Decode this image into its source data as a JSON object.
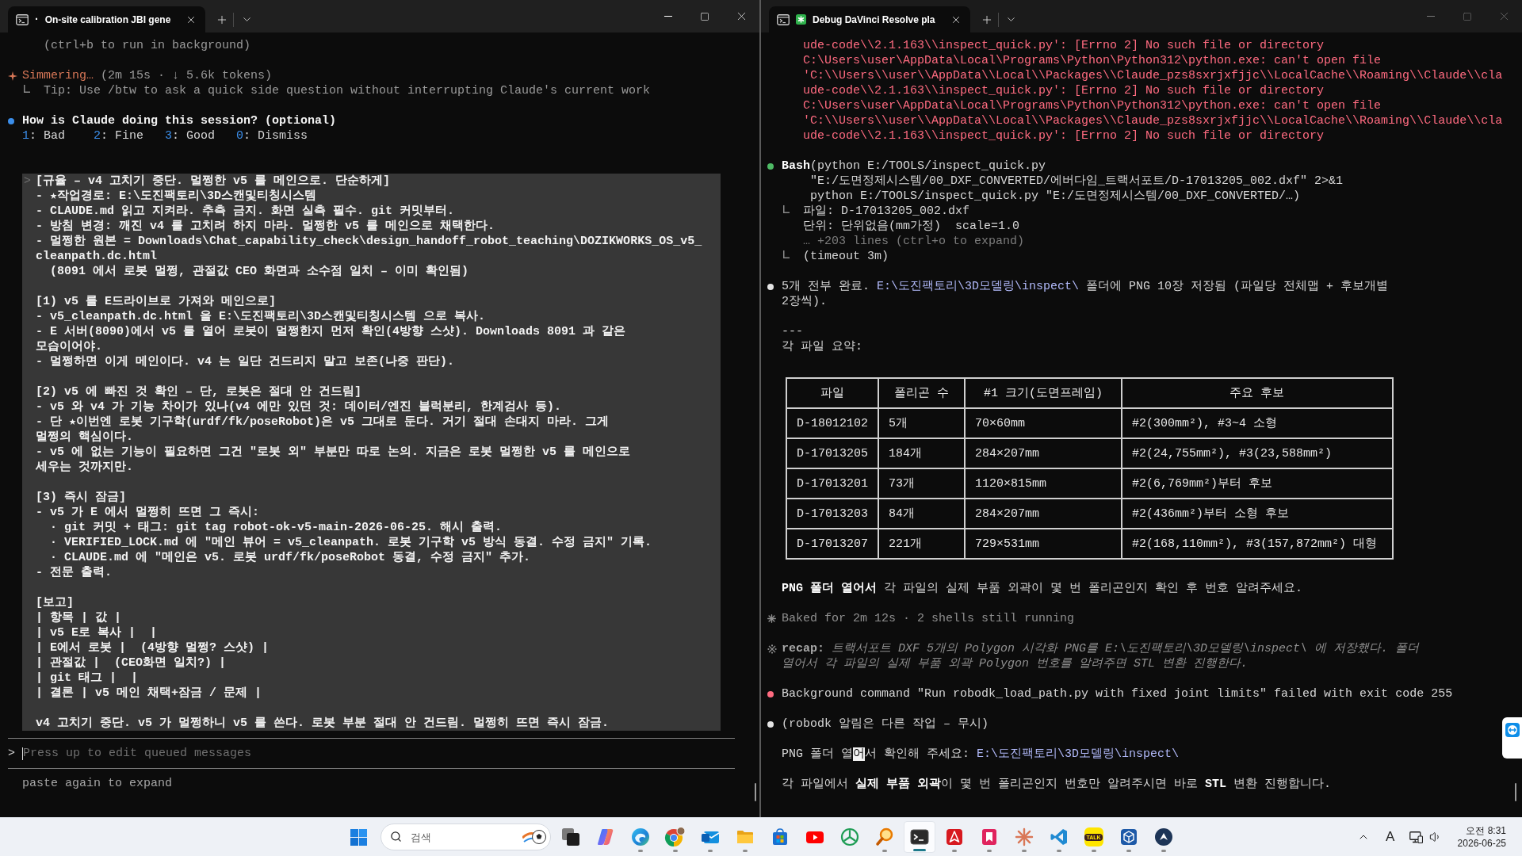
{
  "left_window": {
    "focused": true,
    "tab": {
      "prefix": "·",
      "badge": false,
      "title": "On-site calibration JBI gene",
      "selected": true
    },
    "output": {
      "background_hint": "(ctrl+b to run in background)",
      "spinner": {
        "verb": "Simmering…",
        "detail": "(2m 15s · ↓ 5.6k tokens)"
      },
      "tip": "Tip: Use /btw to ask a quick side question without interrupting Claude's current work",
      "survey": {
        "question": "How is Claude doing this session? (optional)",
        "separator": ":",
        "options": [
          {
            "key": "1",
            "label": "Bad"
          },
          {
            "key": "2",
            "label": "Fine"
          },
          {
            "key": "3",
            "label": "Good"
          },
          {
            "key": "0",
            "label": "Dismiss"
          }
        ]
      }
    },
    "pasted_block": {
      "prompt": ">",
      "groups": [
        [
          {
            "lines": [
              "[규율 – v4 고치기 중단. 멀쩡한 v5 를 메인으로. 단순하게]"
            ]
          },
          {
            "lines": [
              "- ★작업경로: E:\\도진팩토리\\3D스캔및티칭시스템"
            ]
          },
          {
            "lines": [
              "- CLAUDE.md 읽고 지켜라. 추측 금지. 화면 실측 필수. git 커밋부터."
            ]
          },
          {
            "lines": [
              "- 방침 변경: 깨진 v4 를 고치려 하지 마라. 멀쩡한 v5 를 메인으로 채택한다."
            ]
          },
          {
            "lines": [
              "- 멀쩡한 원본 = Downloads\\Chat_capability_check\\design_handoff_robot_teaching\\DOZIKWORKS_OS_v5_",
              "cleanpath.dc.html"
            ],
            "children": [
              {
                "lines": [
                  "(8091 에서 로봇 멀쩡, 관절값 CEO 화면과 소수점 일치 – 이미 확인됨)"
                ]
              }
            ]
          }
        ],
        [
          {
            "lines": [
              "[1) v5 를 E드라이브로 가져와 메인으로]"
            ]
          },
          {
            "lines": [
              "- v5_cleanpath.dc.html 을 E:\\도진팩토리\\3D스캔및티칭시스템 으로 복사."
            ]
          },
          {
            "lines": [
              "- E 서버(8090)에서 v5 를 열어 로봇이 멀쩡한지 먼저 확인(4방향 스샷). Downloads 8091 과 같은",
              "모습이어야."
            ]
          },
          {
            "lines": [
              "- 멀쩡하면 이게 메인이다. v4 는 일단 건드리지 말고 보존(나중 판단)."
            ]
          }
        ],
        [
          {
            "lines": [
              "[2) v5 에 빠진 것 확인 – 단, 로봇은 절대 안 건드림]"
            ]
          },
          {
            "lines": [
              "- v5 와 v4 가 기능 차이가 있나(v4 에만 있던 것: 데이터/엔진 블럭분리, 한계검사 등)."
            ]
          },
          {
            "lines": [
              "- 단 ★이번엔 로봇 기구학(urdf/fk/poseRobot)은 v5 그대로 둔다. 거기 절대 손대지 마라. 그게",
              "멀쩡의 핵심이다."
            ]
          },
          {
            "lines": [
              "- v5 에 없는 기능이 필요하면 그건 \"로봇 외\" 부분만 따로 논의. 지금은 로봇 멀쩡한 v5 를 메인으로",
              "세우는 것까지만."
            ]
          }
        ],
        [
          {
            "lines": [
              "[3) 즉시 잠금]"
            ]
          },
          {
            "lines": [
              "- v5 가 E 에서 멀쩡히 뜨면 그 즉시:"
            ],
            "children": [
              {
                "lines": [
                  "· git 커밋 + 태그: git tag robot-ok-v5-main-2026-06-25. 해시 출력."
                ]
              },
              {
                "lines": [
                  "· VERIFIED_LOCK.md 에 \"메인 뷰어 = v5_cleanpath. 로봇 기구학 v5 방식 동결. 수정 금지\" 기록."
                ]
              },
              {
                "lines": [
                  "· CLAUDE.md 에 \"메인은 v5. 로봇 urdf/fk/poseRobot 동결, 수정 금지\" 추가."
                ]
              }
            ]
          },
          {
            "lines": [
              "- 전문 출력."
            ]
          }
        ],
        [
          {
            "lines": [
              "[보고]"
            ]
          },
          {
            "lines": [
              "| 항목 | 값 |"
            ]
          },
          {
            "lines": [
              "| v5 E로 복사 |  |"
            ]
          },
          {
            "lines": [
              "| E에서 로봇 |  (4방향 멀쩡? 스샷) |"
            ]
          },
          {
            "lines": [
              "| 관절값 |  (CEO화면 일치?) |"
            ]
          },
          {
            "lines": [
              "| git 태그 |  |"
            ]
          },
          {
            "lines": [
              "| 결론 | v5 메인 채택+잠금 / 문제 |"
            ]
          }
        ],
        [
          {
            "lines": [
              "v4 고치기 중단. v5 가 멀쩡하니 v5 를 쓴다. 로봇 부분 절대 안 건드림. 멀쩡히 뜨면 즉시 잠금."
            ]
          }
        ]
      ]
    },
    "input": {
      "prompt": ">",
      "placeholder": "Press up to edit queued messages"
    },
    "footer": "paste again to expand"
  },
  "right_window": {
    "focused": false,
    "tab": {
      "badge": true,
      "title": "Debug DaVinci Resolve pla",
      "selected": true
    },
    "transcript": [
      {
        "kind": "error_output",
        "lines": [
          "ude-code\\\\2.1.163\\\\inspect_quick.py': [Errno 2] No such file or directory",
          "C:\\Users\\user\\AppData\\Local\\Programs\\Python\\Python312\\python.exe: can't open file",
          "'C:\\\\Users\\\\user\\\\AppData\\\\Local\\\\Packages\\\\Claude_pzs8sxrjxfjjc\\\\LocalCache\\\\Roaming\\\\Claude\\\\cla",
          "ude-code\\\\2.1.163\\\\inspect_quick.py': [Errno 2] No such file or directory",
          "C:\\Users\\user\\AppData\\Local\\Programs\\Python\\Python312\\python.exe: can't open file",
          "'C:\\\\Users\\\\user\\\\AppData\\\\Local\\\\Packages\\\\Claude_pzs8sxrjxfjjc\\\\LocalCache\\\\Roaming\\\\Claude\\\\cla",
          "ude-code\\\\2.1.163\\\\inspect_quick.py': [Errno 2] No such file or directory"
        ]
      },
      {
        "kind": "tool_call",
        "color": "#4eba65",
        "command": [
          "**Bash**(python E:/TOOLS/inspect_quick.py",
          "\"E:/도면정제시스템/00_DXF_CONVERTED/에버다임_트랙서포트/D-17013205_002.dxf\" 2>&1",
          "python E:/TOOLS/inspect_quick.py \"E:/도면정제시스템/00_DXF_CONVERTED/…)"
        ],
        "result": [
          {
            "text": "파일: D-17013205_002.dxf",
            "dim": false
          },
          {
            "text": "단위: 단위없음(mm가정)  scale=1.0",
            "dim": false
          },
          {
            "text": "… +203 lines (ctrl+o to expand)",
            "dim": true
          }
        ],
        "footer": "(timeout 3m)"
      },
      {
        "kind": "message",
        "color": "#e4e4e4",
        "lines": [
          [
            {
              "kind": "plain",
              "text": "5개 전부 완료. "
            },
            {
              "kind": "path",
              "text": "E:\\도진팩토리\\3D모델링\\inspect\\"
            },
            {
              "kind": "plain",
              "text": " 폴더에 PNG 10장 저장됨 (파일당 전체맵 + 후보개별"
            }
          ],
          [
            {
              "kind": "plain",
              "text": "2장씩)."
            }
          ]
        ]
      },
      {
        "kind": "rule",
        "text": "---"
      },
      {
        "kind": "text",
        "lines": [
          [
            {
              "kind": "plain",
              "text": "각 파일 요약:"
            }
          ]
        ]
      },
      {
        "kind": "table",
        "columns": [
          "파일",
          "폴리곤 수",
          "#1 크기(도면프레임)",
          "주요 후보"
        ],
        "rows": [
          [
            "D-18012102",
            "5개",
            "70×60mm",
            "#2(300mm²), #3~4 소형"
          ],
          [
            "D-17013205",
            "184개",
            "284×207mm",
            "#2(24,755mm²), #3(23,588mm²)"
          ],
          [
            "D-17013201",
            "73개",
            "1120×815mm",
            "#2(6,769mm²)부터 후보"
          ],
          [
            "D-17013203",
            "84개",
            "284×207mm",
            "#2(436mm²)부터 소형 후보"
          ],
          [
            "D-17013207",
            "221개",
            "729×531mm",
            "#2(168,110mm²), #3(157,872mm²) 대형"
          ]
        ]
      },
      {
        "kind": "text",
        "lines": [
          [
            {
              "kind": "bold",
              "text": "PNG 폴더 열어서"
            },
            {
              "kind": "plain",
              "text": " 각 파일의 실제 부품 외곽이 몇 번 폴리곤인지 확인 후 번호 알려주세요."
            }
          ]
        ]
      },
      {
        "kind": "timing",
        "text": "Baked for 2m 12s · 2 shells still running"
      },
      {
        "kind": "recap",
        "label": "recap:",
        "lines": [
          "트랙서포트 DXF 5개의 Polygon 시각화 PNG를 E:\\도진팩토리\\3D모델링\\inspect\\ 에 저장했다. 폴더",
          "열어서 각 파일의 실제 부품 외곽 Polygon 번호를 알려주면 STL 변환 진행한다."
        ]
      },
      {
        "kind": "message",
        "color": "#ff6b80",
        "lines": [
          [
            {
              "kind": "plain",
              "text": "Background command \"Run robodk_load_path.py with fixed joint limits\" failed with exit code 255"
            }
          ]
        ]
      },
      {
        "kind": "message",
        "color": "#e4e4e4",
        "lines": [
          [
            {
              "kind": "plain",
              "text": "(robodk 알림은 다른 작업 – 무시)"
            }
          ]
        ]
      },
      {
        "kind": "text",
        "lines": [
          [
            {
              "kind": "plain",
              "text": "PNG 폴더 열"
            },
            {
              "kind": "cursor",
              "text": "어"
            },
            {
              "kind": "plain",
              "text": "서 확인해 주세요: "
            },
            {
              "kind": "path",
              "text": "E:\\도진팩토리\\3D모델링\\inspect\\"
            }
          ]
        ]
      },
      {
        "kind": "text",
        "lines": [
          [
            {
              "kind": "plain",
              "text": "각 파일에서 "
            },
            {
              "kind": "bold",
              "text": "실제 부품 외곽"
            },
            {
              "kind": "plain",
              "text": "이 몇 번 폴리곤인지 번호만 알려주시면 바로 "
            },
            {
              "kind": "bold",
              "text": "STL"
            },
            {
              "kind": "plain",
              "text": " 변환 진행합니다."
            }
          ]
        ]
      }
    ]
  },
  "taskbar": {
    "search": {
      "placeholder": "검색"
    },
    "apps": [
      {
        "kind": "task_view",
        "running": false,
        "selected": false
      },
      {
        "kind": "copilot",
        "running": false,
        "selected": false
      },
      {
        "kind": "edge",
        "running": true,
        "selected": false
      },
      {
        "kind": "chrome",
        "running": true,
        "selected": false
      },
      {
        "kind": "mail",
        "running": true,
        "selected": false
      },
      {
        "kind": "folder",
        "running": true,
        "selected": false
      },
      {
        "kind": "store",
        "running": false,
        "selected": false
      },
      {
        "kind": "video",
        "running": false,
        "selected": false
      },
      {
        "kind": "tri_node",
        "running": false,
        "selected": false
      },
      {
        "kind": "magnifier",
        "running": true,
        "selected": false
      },
      {
        "kind": "terminal",
        "running": true,
        "selected": true
      },
      {
        "kind": "pdf",
        "running": true,
        "selected": false
      },
      {
        "kind": "pdf_red",
        "running": true,
        "selected": false
      },
      {
        "kind": "spark",
        "running": true,
        "selected": false
      },
      {
        "kind": "code",
        "running": true,
        "selected": false
      },
      {
        "kind": "chat",
        "label": "TALK",
        "running": true,
        "selected": false
      },
      {
        "kind": "box3d",
        "running": true,
        "selected": false
      },
      {
        "kind": "circle_app",
        "running": true,
        "selected": false
      }
    ],
    "tray": {
      "input_mode": "A"
    },
    "clock": {
      "time": "오전 8:31",
      "date": "2026-06-25"
    }
  }
}
